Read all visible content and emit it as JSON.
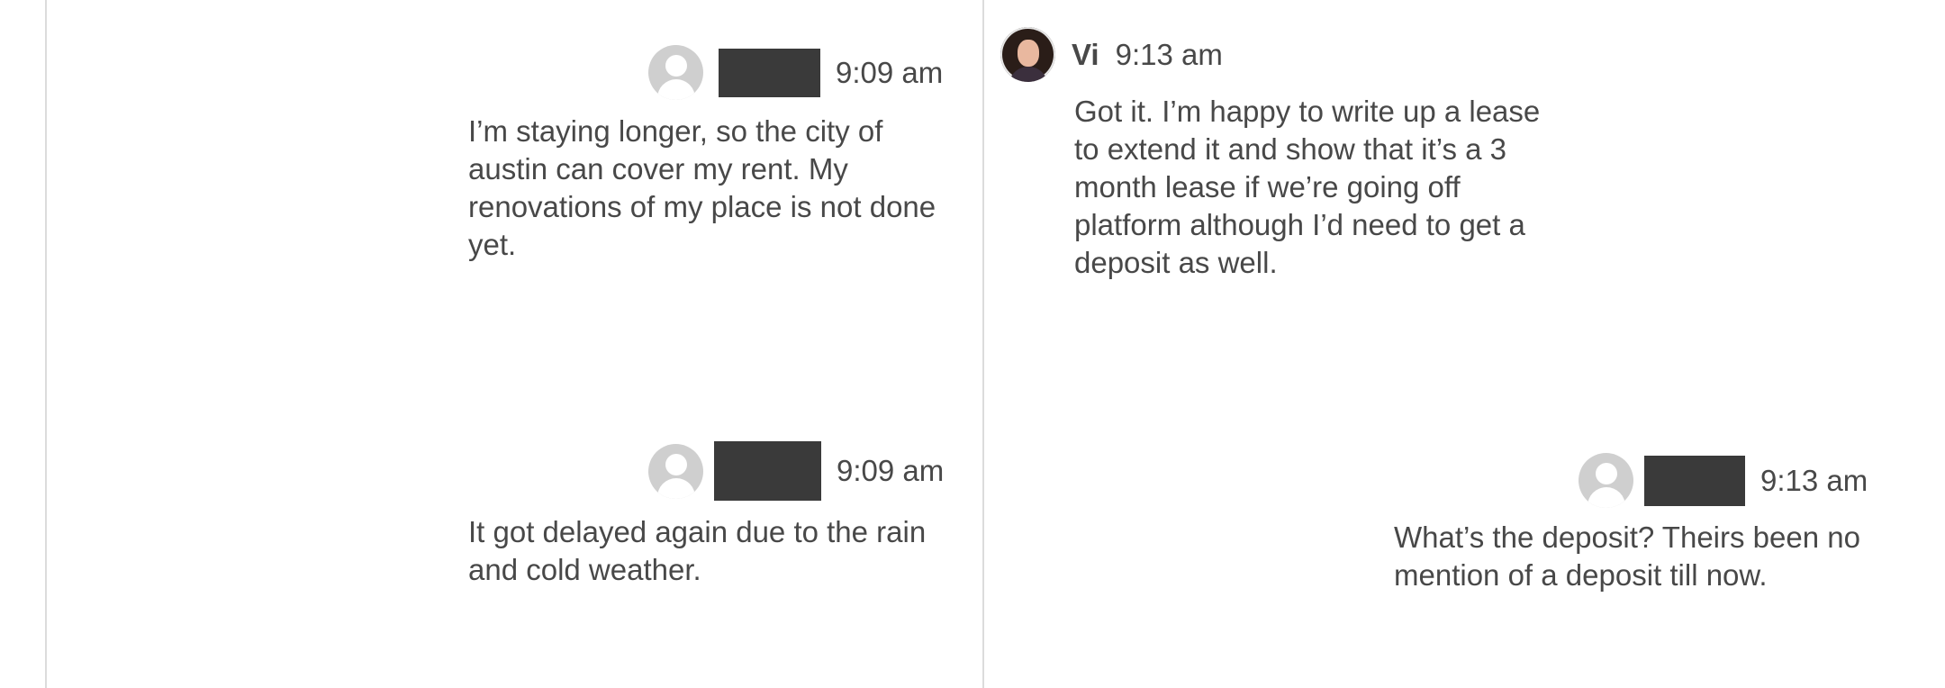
{
  "messages": [
    {
      "sender": "",
      "time": "9:09 am",
      "text": "I’m staying longer, so the city of austin can cover my rent. My renovations of my place is not done yet."
    },
    {
      "sender": "",
      "time": "9:09 am",
      "text": "It got delayed again due to the rain and cold weather."
    },
    {
      "sender": "Vi",
      "time": "9:13 am",
      "text": "Got it. I’m happy to write up a lease to extend it and show that it’s a 3 month lease if we’re going off platform although I’d need to get a deposit as well."
    },
    {
      "sender": "",
      "time": "9:13 am",
      "text": "What’s the deposit? Theirs been no mention of a deposit till now."
    }
  ],
  "icons": {
    "default_avatar": "user-silhouette-icon",
    "host_avatar": "host-photo"
  }
}
